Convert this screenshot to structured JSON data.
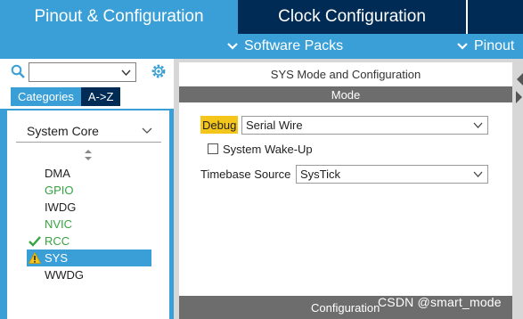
{
  "tabs": {
    "pinout": "Pinout & Configuration",
    "clock": "Clock Configuration"
  },
  "subbar": {
    "software_packs": "Software Packs",
    "pinout": "Pinout"
  },
  "left": {
    "search_value": "",
    "category_tabs": [
      "Categories",
      "A->Z"
    ],
    "group": "System Core",
    "peripherals": [
      {
        "label": "DMA",
        "state": "none"
      },
      {
        "label": "GPIO",
        "state": "configured"
      },
      {
        "label": "IWDG",
        "state": "none"
      },
      {
        "label": "NVIC",
        "state": "configured"
      },
      {
        "label": "RCC",
        "state": "ok"
      },
      {
        "label": "SYS",
        "state": "warning"
      },
      {
        "label": "WWDG",
        "state": "none"
      }
    ]
  },
  "right": {
    "title": "SYS Mode and Configuration",
    "mode_header": "Mode",
    "debug_label": "Debug",
    "debug_value": "Serial Wire",
    "wakeup_label": "System Wake-Up",
    "timebase_label": "Timebase Source",
    "timebase_value": "SysTick",
    "config_header": "Configuration"
  },
  "watermark": "CSDN @smart_mode",
  "colors": {
    "accent_blue": "#3a9fd6",
    "navy": "#002b54",
    "green": "#35a341",
    "warning": "#f4c51a",
    "gray_bar": "#6d6d6d"
  }
}
